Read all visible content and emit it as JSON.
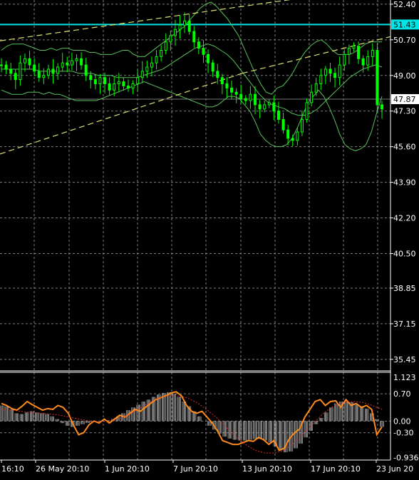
{
  "chart_data": [
    {
      "type": "candlestick",
      "panel": "price",
      "y_ticks": [
        "52.40",
        "50.70",
        "49.00",
        "47.30",
        "45.60",
        "43.90",
        "42.20",
        "40.50",
        "38.85",
        "37.15",
        "35.45"
      ],
      "y_tick_values": [
        52.4,
        50.7,
        49.0,
        47.3,
        45.6,
        43.9,
        42.2,
        40.5,
        38.85,
        37.15,
        35.45
      ],
      "ylim": [
        34.9,
        52.6
      ],
      "grid": true,
      "price_labels": [
        {
          "text": "51.43",
          "value": 51.43,
          "color": "#00e5e5"
        },
        {
          "text": "47.87",
          "value": 47.87,
          "color": "#ffffff"
        }
      ],
      "horizontal_lines": [
        {
          "value": 51.43,
          "color": "#00e5e5"
        },
        {
          "value": 47.87,
          "color": "#777777"
        }
      ],
      "series": [
        {
          "kind": "close",
          "color": "#00ff00",
          "values": [
            49.5,
            49.3,
            49.1,
            48.8,
            49.6,
            49.8,
            49.5,
            49.2,
            48.9,
            49.0,
            49.3,
            49.1,
            49.4,
            49.6,
            49.5,
            49.7,
            49.8,
            49.5,
            49.0,
            48.8,
            48.6,
            48.9,
            48.6,
            48.3,
            48.6,
            48.7,
            48.5,
            48.4,
            48.6,
            48.9,
            49.2,
            49.4,
            49.6,
            49.9,
            50.2,
            50.6,
            50.9,
            51.2,
            51.4,
            51.6,
            51.1,
            50.6,
            50.3,
            50.0,
            49.6,
            49.2,
            48.9,
            48.6,
            48.4,
            48.2,
            48.1,
            47.9,
            47.8,
            48.1,
            47.6,
            47.4,
            47.6,
            47.7,
            47.3,
            46.9,
            46.4,
            46.0,
            45.9,
            46.3,
            46.9,
            47.7,
            48.2,
            48.6,
            49.0,
            49.3,
            49.1,
            48.9,
            49.5,
            50.0,
            50.3,
            50.4,
            49.8,
            49.5,
            49.9,
            50.2,
            47.6,
            47.4
          ]
        },
        {
          "kind": "bollinger_upper",
          "color": "#58c058",
          "values": [
            50.2,
            50.4,
            50.5,
            50.5,
            50.5,
            50.4,
            50.3,
            50.2,
            50.2,
            50.3,
            50.2,
            50.3,
            50.3,
            50.2,
            50.2,
            50.2,
            50.1,
            50.1,
            50.0,
            50.0,
            50.0,
            50.1,
            50.2,
            50.2,
            50.0,
            49.9,
            49.9,
            50.1,
            50.3,
            50.5,
            50.7,
            50.9,
            51.1,
            51.3,
            51.6,
            51.9,
            52.2,
            52.4,
            52.5,
            52.3,
            52.0,
            51.7,
            51.3,
            50.9,
            50.3,
            49.7,
            49.1,
            48.6,
            48.2,
            48.1,
            48.4,
            48.5,
            48.8,
            49.2,
            49.7,
            50.1,
            50.4,
            50.6,
            50.7,
            50.5,
            50.2,
            50.0,
            50.0,
            50.0,
            50.1,
            50.3,
            50.5,
            50.6,
            50.6,
            50.6
          ]
        },
        {
          "kind": "bollinger_middle",
          "color": "#58c058",
          "values": [
            49.3,
            49.3,
            49.3,
            49.3,
            49.3,
            49.3,
            49.2,
            49.2,
            49.2,
            49.2,
            49.2,
            49.2,
            49.1,
            49.1,
            49.1,
            49.0,
            49.0,
            49.0,
            48.9,
            48.9,
            48.9,
            48.9,
            49.0,
            49.1,
            49.2,
            49.3,
            49.5,
            49.7,
            49.9,
            50.1,
            50.3,
            50.4,
            50.5,
            50.4,
            50.2,
            50.0,
            49.7,
            49.3,
            48.9,
            48.5,
            48.1,
            47.8,
            47.6,
            47.5,
            47.4,
            47.2,
            47.1,
            47.1,
            47.2,
            47.4,
            47.7,
            48.0,
            48.3,
            48.6,
            48.9,
            49.1,
            49.3,
            49.4,
            49.5,
            49.4
          ]
        },
        {
          "kind": "bollinger_lower",
          "color": "#58c058",
          "values": [
            48.3,
            48.2,
            48.1,
            48.1,
            48.1,
            48.2,
            48.2,
            48.2,
            48.1,
            48.2,
            48.1,
            48.1,
            48.0,
            47.9,
            47.8,
            47.8,
            47.8,
            47.8,
            47.8,
            47.9,
            48.0,
            48.1,
            48.2,
            48.3,
            48.4,
            48.5,
            48.6,
            48.7,
            48.6,
            48.5,
            48.4,
            48.3,
            48.2,
            48.1,
            48.0,
            47.9,
            47.8,
            47.7,
            47.6,
            47.5,
            47.5,
            47.6,
            47.8,
            48.0,
            48.0,
            47.9,
            47.6,
            47.3,
            46.8,
            46.2,
            45.9,
            45.7,
            45.6,
            45.6,
            45.7,
            46.0,
            46.5,
            47.1,
            47.7,
            48.0,
            48.3,
            48.0,
            47.5,
            46.9,
            46.2,
            45.7,
            45.5,
            45.4,
            45.5,
            45.7,
            46.3,
            47.2,
            48.0
          ]
        },
        {
          "kind": "channel_upper",
          "color": "#e0e070",
          "dash": "8,5",
          "from": [
            0,
            50.65
          ],
          "to": [
            1,
            53.3
          ]
        },
        {
          "kind": "channel_upper_right",
          "color": "#e0e070",
          "dash": "8,5",
          "from": [
            0.62,
            49.1
          ],
          "to": [
            1,
            50.85
          ]
        },
        {
          "kind": "channel_lower",
          "color": "#e0e070",
          "dash": "8,5",
          "from": [
            0,
            45.25
          ],
          "to": [
            0.62,
            49.1
          ]
        }
      ]
    },
    {
      "type": "histogram",
      "panel": "oscillator",
      "y_ticks": [
        "1.123",
        "0.70",
        "0.00",
        "-0.30",
        "-0.936"
      ],
      "y_tick_values": [
        1.123,
        0.7,
        0.0,
        -0.3,
        -0.936
      ],
      "ylim": [
        -1.0,
        1.25
      ],
      "series": [
        {
          "kind": "histogram",
          "color": "#c8c8c8",
          "values": [
            0.4,
            0.38,
            0.3,
            0.2,
            0.18,
            0.22,
            0.25,
            0.22,
            0.2,
            0.18,
            0.12,
            0.05,
            -0.05,
            -0.12,
            -0.15,
            -0.12,
            -0.08,
            -0.05,
            -0.02,
            0.0,
            0.0,
            0.02,
            0.05,
            0.12,
            0.2,
            0.28,
            0.35,
            0.42,
            0.5,
            0.55,
            0.62,
            0.68,
            0.72,
            0.74,
            0.7,
            0.62,
            0.5,
            0.38,
            0.25,
            0.12,
            0.0,
            -0.12,
            -0.22,
            -0.32,
            -0.4,
            -0.45,
            -0.48,
            -0.5,
            -0.5,
            -0.48,
            -0.46,
            -0.46,
            -0.5,
            -0.55,
            -0.65,
            -0.75,
            -0.8,
            -0.78,
            -0.7,
            -0.58,
            -0.42,
            -0.25,
            -0.08,
            0.08,
            0.22,
            0.35,
            0.45,
            0.5,
            0.5,
            0.48,
            0.42,
            0.38,
            0.32,
            0.2,
            0.05,
            -0.15
          ]
        },
        {
          "kind": "signal_line",
          "color": "#ff8c1a",
          "values": [
            0.45,
            0.4,
            0.32,
            0.28,
            0.38,
            0.5,
            0.42,
            0.35,
            0.28,
            0.32,
            0.3,
            0.4,
            0.35,
            0.2,
            -0.1,
            -0.35,
            -0.3,
            -0.1,
            0.0,
            -0.05,
            0.05,
            -0.05,
            0.05,
            0.15,
            0.1,
            0.2,
            0.3,
            0.25,
            0.35,
            0.45,
            0.55,
            0.6,
            0.65,
            0.72,
            0.75,
            0.65,
            0.4,
            0.25,
            0.2,
            0.25,
            0.1,
            -0.05,
            -0.25,
            -0.5,
            -0.55,
            -0.6,
            -0.6,
            -0.55,
            -0.5,
            -0.52,
            -0.42,
            -0.48,
            -0.6,
            -0.5,
            -0.75,
            -0.7,
            -0.45,
            -0.3,
            -0.2,
            0.1,
            0.3,
            0.5,
            0.55,
            0.4,
            0.5,
            0.52,
            0.35,
            0.55,
            0.4,
            0.45,
            0.35,
            0.4,
            0.3,
            -0.35,
            -0.15
          ]
        },
        {
          "kind": "signal_ma",
          "color": "#e03030",
          "dash": "2,2",
          "values": [
            0.3,
            0.28,
            0.25,
            0.22,
            0.2,
            0.18,
            0.15,
            0.1,
            0.05,
            0.0,
            -0.02,
            0.0,
            0.05,
            0.15,
            0.3,
            0.45,
            0.58,
            0.65,
            0.65,
            0.6,
            0.48,
            0.3,
            0.1,
            -0.15,
            -0.4,
            -0.6,
            -0.75,
            -0.82,
            -0.82,
            -0.75,
            -0.55,
            -0.3,
            -0.05,
            0.2,
            0.38,
            0.48,
            0.5,
            0.48,
            0.4,
            0.3
          ]
        }
      ]
    }
  ],
  "x_axis": {
    "labels": [
      "16:10",
      "26 May 20:10",
      "1 Jun 20:10",
      "7 Jun 20:10",
      "13 Jun 20:10",
      "17 Jun 20:10",
      "23 Jun 20"
    ]
  },
  "colors": {
    "background": "#000000",
    "grid": "#808080",
    "axis_text": "#ffffff",
    "bull_candle": "#00ff00",
    "cyan_line": "#00e5e5",
    "divider": "#ffffff"
  }
}
